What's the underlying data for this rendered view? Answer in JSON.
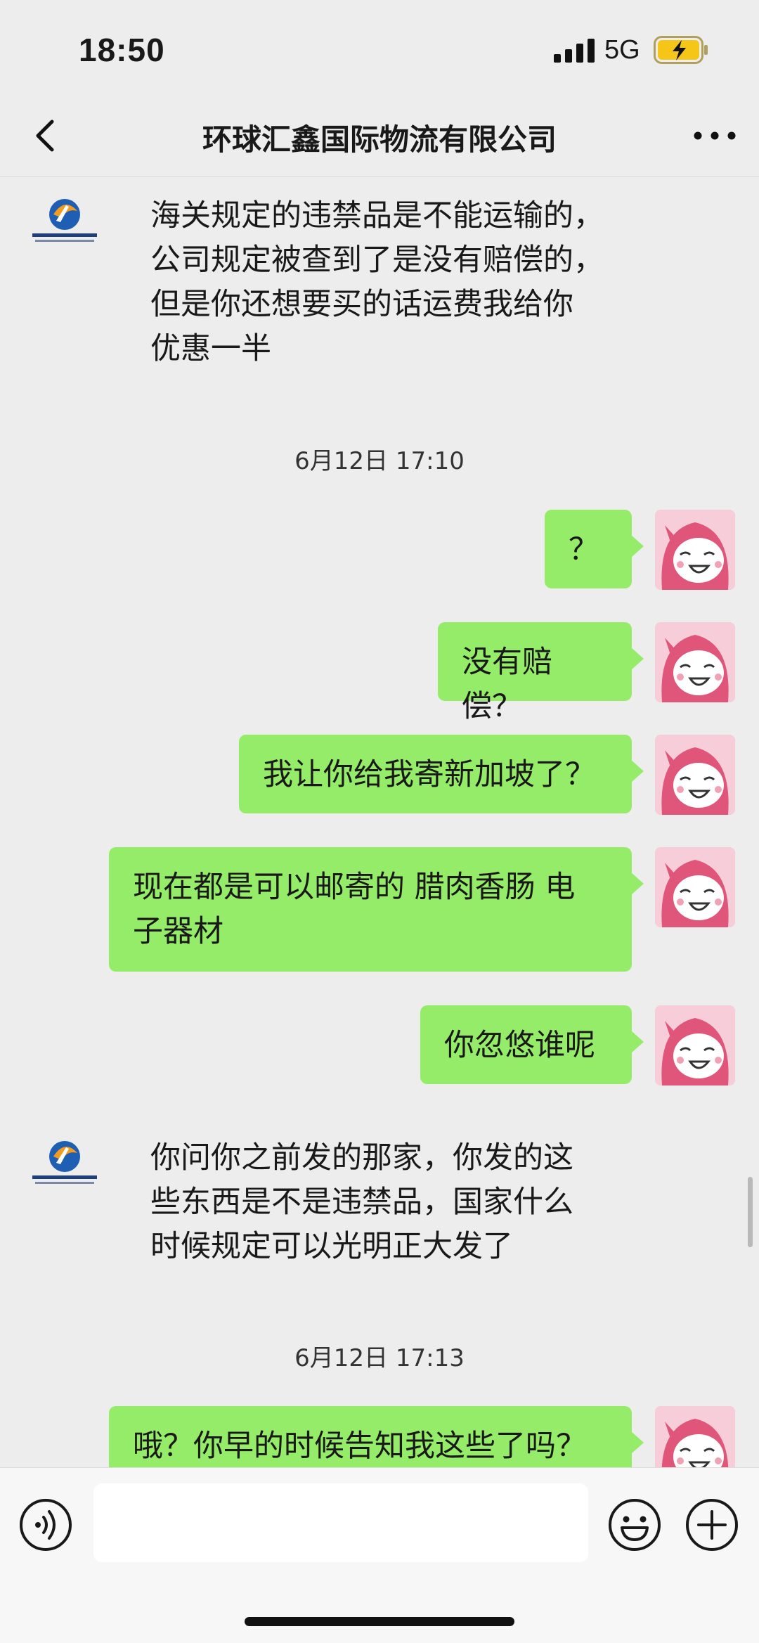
{
  "status_bar": {
    "time": "18:50",
    "network": "5G",
    "signal_icon": "signal-bars-icon",
    "battery_icon": "battery-charging-icon",
    "battery_color": "#f5c518"
  },
  "nav": {
    "title": "环球汇鑫国际物流有限公司",
    "back_icon": "chevron-left-icon",
    "more_icon": "more-dots-icon"
  },
  "colors": {
    "background": "#ededed",
    "bubble_green": "#95ec69",
    "user_avatar_pink": "#e0567a"
  },
  "messages": [
    {
      "sender": "contact",
      "text": "海关规定的违禁品是不能运输的，\n公司规定被查到了是没有赔偿的，\n但是你还想要买的话运费我给你\n优惠一半"
    },
    {
      "type": "time",
      "text": "6月12日 17:10"
    },
    {
      "sender": "me",
      "text": "？"
    },
    {
      "sender": "me",
      "text": "没有赔偿？"
    },
    {
      "sender": "me",
      "text": "我让你给我寄新加坡了？"
    },
    {
      "sender": "me",
      "text": "现在都是可以邮寄的 腊肉香肠 电\n子器材"
    },
    {
      "sender": "me",
      "text": "你忽悠谁呢"
    },
    {
      "sender": "contact",
      "text": "你问你之前发的那家，你发的这\n些东西是不是违禁品，国家什么\n时候规定可以光明正大发了"
    },
    {
      "type": "time",
      "text": "6月12日 17:13"
    },
    {
      "sender": "me",
      "text": "哦？你早的时候告知我这些了吗？"
    }
  ],
  "input_bar": {
    "value": "",
    "placeholder": "",
    "voice_icon": "voice-icon",
    "emoji_icon": "emoji-icon",
    "plus_icon": "plus-icon"
  }
}
